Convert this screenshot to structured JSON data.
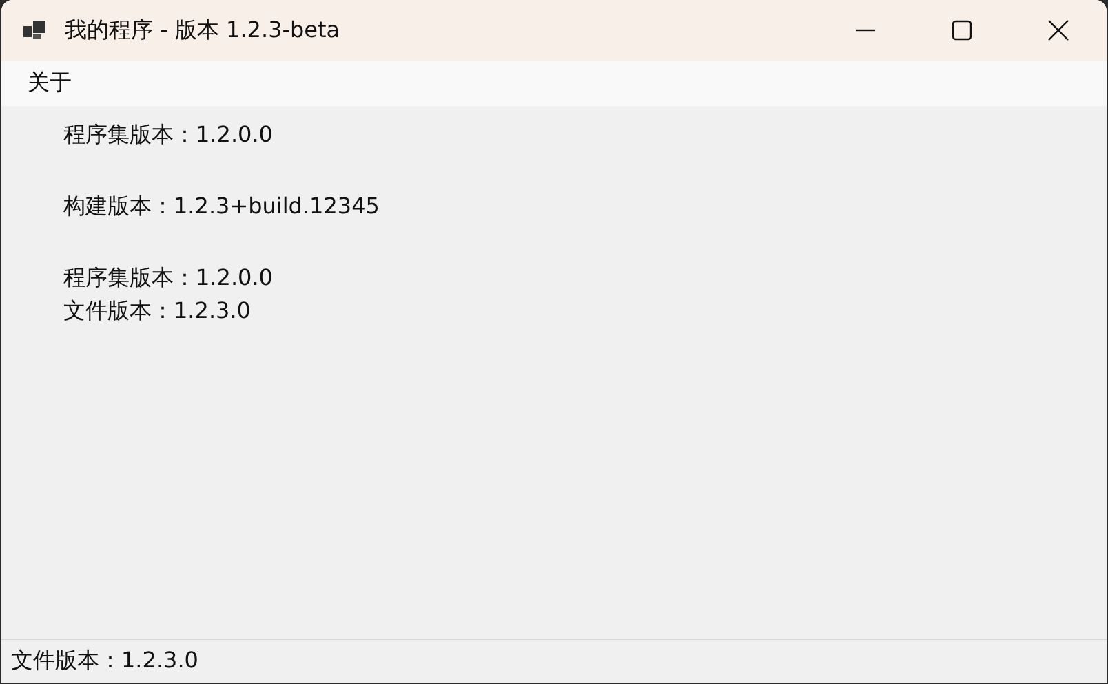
{
  "window": {
    "title": "我的程序 - 版本 1.2.3-beta"
  },
  "menu": [
    {
      "label": "关于"
    }
  ],
  "label_groups": [
    [
      "程序集版本：1.2.0.0"
    ],
    [
      "构建版本：1.2.3+build.12345"
    ],
    [
      "程序集版本：1.2.0.0",
      "文件版本：1.2.3.0"
    ]
  ],
  "status_bar": {
    "text": "文件版本：1.2.3.0"
  }
}
